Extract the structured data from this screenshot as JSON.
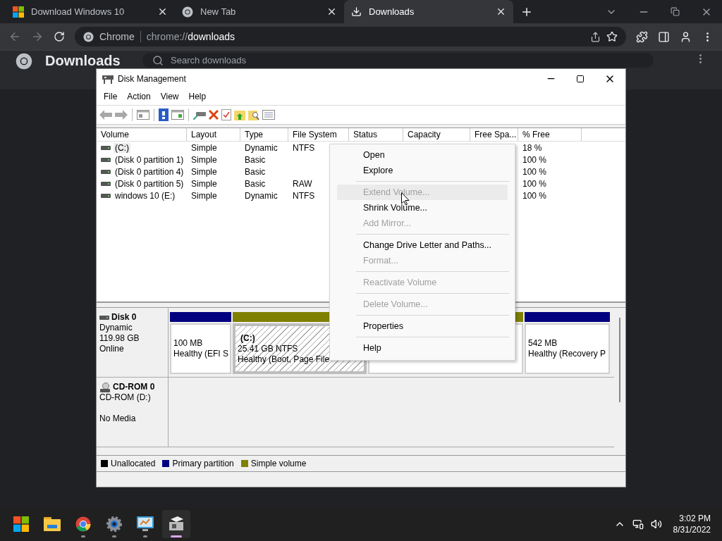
{
  "browser": {
    "tabs": [
      {
        "title": "Download Windows 10",
        "kind": "windows",
        "selected": false
      },
      {
        "title": "New Tab",
        "kind": "chrome",
        "selected": false
      },
      {
        "title": "Downloads",
        "kind": "download",
        "selected": true
      }
    ],
    "omnibox": {
      "site_label": "Chrome",
      "url_scheme": "chrome://",
      "url_path": "downloads"
    }
  },
  "downloads_page": {
    "title": "Downloads",
    "search_placeholder": "Search downloads"
  },
  "disk_management": {
    "title": "Disk Management",
    "menu": [
      "File",
      "Action",
      "View",
      "Help"
    ],
    "columns": [
      "Volume",
      "Layout",
      "Type",
      "File System",
      "Status",
      "Capacity",
      "Free Spa...",
      "% Free"
    ],
    "volumes": [
      {
        "volume": "(C:)",
        "layout": "Simple",
        "type": "Dynamic",
        "file_system": "NTFS",
        "pct_free": "18 %",
        "selected": true
      },
      {
        "volume": "(Disk 0 partition 1)",
        "layout": "Simple",
        "type": "Basic",
        "pct_free": "100 %",
        "selected": false
      },
      {
        "volume": "(Disk 0 partition 4)",
        "layout": "Simple",
        "type": "Basic",
        "pct_free": "100 %",
        "selected": false
      },
      {
        "volume": "(Disk 0 partition 5)",
        "layout": "Simple",
        "type": "Basic",
        "file_system": "RAW",
        "pct_free": "100 %",
        "selected": false
      },
      {
        "volume": "windows 10 (E:)",
        "layout": "Simple",
        "type": "Dynamic",
        "file_system": "NTFS",
        "pct_free": "100 %",
        "selected": false
      }
    ],
    "disks": [
      {
        "name": "Disk 0",
        "kind": "disk",
        "type": "Dynamic",
        "size": "119.98 GB",
        "status": "Online",
        "partitions": [
          {
            "size": "100 MB",
            "health": "Healthy (EFI S",
            "color": "#000080",
            "selected": false
          },
          {
            "label": "(C:)",
            "size": "25.41 GB NTFS",
            "health": "Healthy (Boot, Page File",
            "color": "#808000",
            "selected": true
          },
          {
            "color": "#808000",
            "selected": false
          },
          {
            "size": "542 MB",
            "health": "Healthy (Recovery P",
            "color": "#000080",
            "selected": false
          }
        ]
      },
      {
        "name": "CD-ROM 0",
        "kind": "cdrom",
        "type": "CD-ROM (D:)",
        "status": "No Media"
      }
    ],
    "legend": [
      {
        "label": "Unallocated",
        "color": "#000000"
      },
      {
        "label": "Primary partition",
        "color": "#000080"
      },
      {
        "label": "Simple volume",
        "color": "#808000"
      }
    ],
    "context_menu": [
      {
        "kind": "item",
        "label": "Open",
        "disabled": false,
        "highlighted": false
      },
      {
        "kind": "item",
        "label": "Explore",
        "disabled": false,
        "highlighted": false
      },
      {
        "kind": "separator"
      },
      {
        "kind": "item",
        "label": "Extend Volume...",
        "disabled": true,
        "highlighted": true
      },
      {
        "kind": "item",
        "label": "Shrink Volume...",
        "disabled": false,
        "highlighted": false
      },
      {
        "kind": "item",
        "label": "Add Mirror...",
        "disabled": true,
        "highlighted": false
      },
      {
        "kind": "separator"
      },
      {
        "kind": "item",
        "label": "Change Drive Letter and Paths...",
        "disabled": false,
        "highlighted": false
      },
      {
        "kind": "item",
        "label": "Format...",
        "disabled": true,
        "highlighted": false
      },
      {
        "kind": "separator"
      },
      {
        "kind": "item",
        "label": "Reactivate Volume",
        "disabled": true,
        "highlighted": false
      },
      {
        "kind": "separator"
      },
      {
        "kind": "item",
        "label": "Delete Volume...",
        "disabled": true,
        "highlighted": false
      },
      {
        "kind": "separator"
      },
      {
        "kind": "item",
        "label": "Properties",
        "disabled": false,
        "highlighted": false
      },
      {
        "kind": "separator"
      },
      {
        "kind": "item",
        "label": "Help",
        "disabled": false,
        "highlighted": false
      }
    ]
  },
  "taskbar": {
    "apps": [
      {
        "kind": "start",
        "running": false,
        "active": false
      },
      {
        "kind": "explorer",
        "running": false,
        "active": false
      },
      {
        "kind": "chrome",
        "running": true,
        "active": false
      },
      {
        "kind": "settings",
        "running": true,
        "active": false
      },
      {
        "kind": "control-panel",
        "running": true,
        "active": false
      },
      {
        "kind": "disk-management",
        "running": true,
        "active": true
      }
    ],
    "time": "3:02 PM",
    "date": "8/31/2022"
  }
}
